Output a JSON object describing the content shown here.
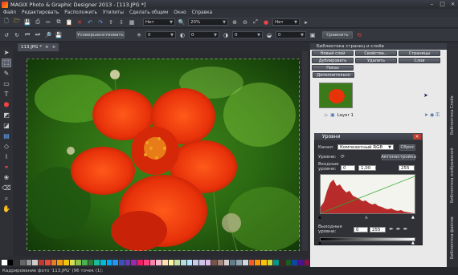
{
  "window": {
    "title": "MAGIX Photo & Graphic Designer 2013 - [113.JPG *]",
    "controls": [
      "–",
      "□",
      "×"
    ]
  },
  "menu": [
    "Файл",
    "Редактировать",
    "Расположить",
    "Утилиты",
    "Сделать общим",
    "Окно",
    "Справка"
  ],
  "toolbar1": {
    "zoom_value": "20%",
    "style_value": "Нет",
    "style_value2": "Нет"
  },
  "toolbar2": {
    "button_edit": "Усовершенствовать",
    "field1": "0",
    "field2": "0",
    "field3": "0",
    "field4": "0",
    "compare_btn": "Сравнить"
  },
  "doc_tab": {
    "label": "113.JPG *",
    "close": "×",
    "add": "+"
  },
  "right_panel": {
    "title": "Библиотека страниц и слоёв",
    "buttons": [
      "Новый слой",
      "Свойства...",
      "Страницы",
      "Дублировать",
      "Удалить",
      "Слои",
      "Показ",
      "Дополнительно"
    ],
    "layer_name": "Layer 1"
  },
  "side_tabs": [
    "Библиотека Слоёв",
    "Библиотека изображений",
    "Библиотека файлов"
  ],
  "levels": {
    "title": "Уровни",
    "channel_label": "Канал:",
    "channel_value": "Композитный RGB",
    "reset_btn": "Сброс",
    "levels_label": "Уровни:",
    "input_label": "Входные уровни:",
    "input_values": [
      "0",
      "1,00",
      "255"
    ],
    "auto_btn": "Автонастройка",
    "output_label": "Выходные уровни:",
    "output_values": [
      "0",
      "255"
    ]
  },
  "status": {
    "text": "Кадрирование фото '113.JPG' (96 точек (1):"
  },
  "palette_colors": [
    "#ffffff",
    "#000000",
    "#333333",
    "#666666",
    "#999999",
    "#cccccc",
    "#c0392b",
    "#e74c3c",
    "#e67e22",
    "#f39c12",
    "#f1c40f",
    "#d4e157",
    "#8bc34a",
    "#4caf50",
    "#2e7d32",
    "#1abc9c",
    "#00bcd4",
    "#03a9f4",
    "#2196f3",
    "#3f51b5",
    "#673ab7",
    "#9c27b0",
    "#e91e63",
    "#ff4081",
    "#ff80ab",
    "#f8bbd0",
    "#ffe0b2",
    "#fff59d",
    "#c5e1a5",
    "#b2dfdb",
    "#b3e5fc",
    "#c5cae9",
    "#d1c4e9",
    "#e1bee7",
    "#795548",
    "#a1887f",
    "#d7ccc8",
    "#607d8b",
    "#90a4ae",
    "#cfd8dc",
    "#ff5722",
    "#ff9800",
    "#ffc107",
    "#cddc39",
    "#009688",
    "#3e2723",
    "#1b5e20",
    "#0d47a1",
    "#4a148c",
    "#880e4f"
  ]
}
